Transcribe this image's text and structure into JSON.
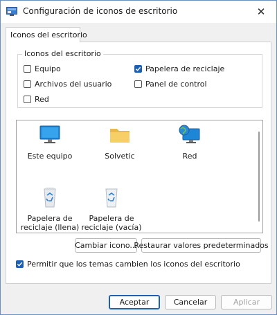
{
  "window": {
    "title": "Configuración de iconos de escritorio",
    "close_glyph": "✕"
  },
  "tabs": [
    {
      "label": "Iconos del escritorio",
      "selected": true
    }
  ],
  "group": {
    "title": "Iconos del escritorio",
    "checkboxes": [
      {
        "label": "Equipo",
        "checked": false
      },
      {
        "label": "Papelera de reciclaje",
        "checked": true
      },
      {
        "label": "Archivos del usuario",
        "checked": false
      },
      {
        "label": "Panel de control",
        "checked": false
      },
      {
        "label": "Red",
        "checked": false
      }
    ]
  },
  "icon_list": [
    {
      "label": "Este equipo",
      "icon": "monitor-icon"
    },
    {
      "label": "Solvetic",
      "icon": "folder-icon"
    },
    {
      "label": "Red",
      "icon": "network-globe-icon"
    },
    {
      "label": "Papelera de reciclaje (llena)",
      "icon": "recycle-bin-full-icon"
    },
    {
      "label": "Papelera de reciclaje (vacía)",
      "icon": "recycle-bin-empty-icon"
    }
  ],
  "buttons": {
    "change_icon": "Cambiar icono...",
    "restore_defaults": "Restaurar valores predeterminados",
    "accept": "Aceptar",
    "cancel": "Cancelar",
    "apply": "Aplicar"
  },
  "allow_themes": {
    "label": "Permitir que los temas cambien los iconos del escritorio",
    "checked": true
  },
  "colors": {
    "accent": "#1f5fb0",
    "background": "#f0f0f0",
    "panel": "#ffffff"
  }
}
